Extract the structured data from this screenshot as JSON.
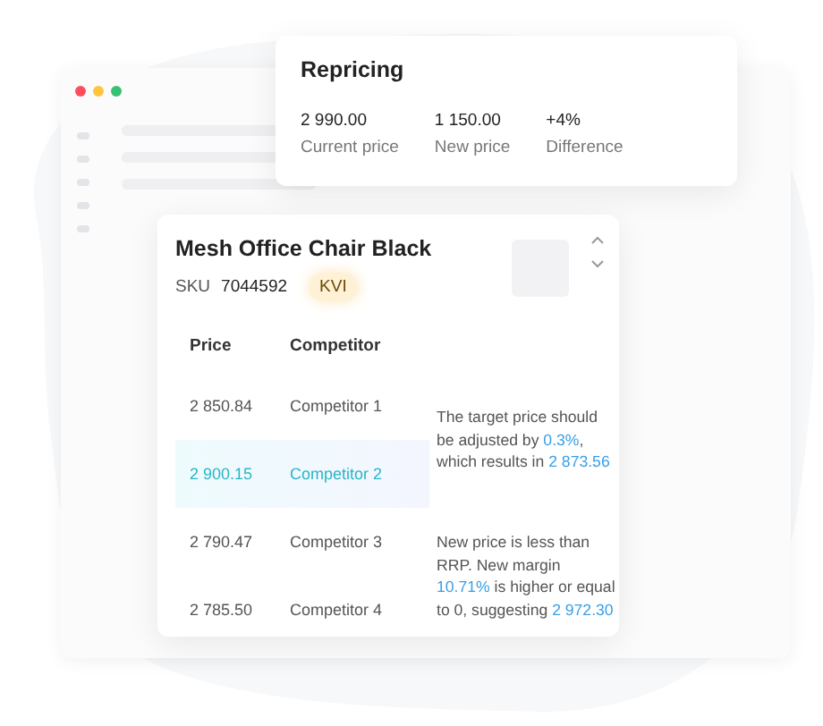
{
  "repricing": {
    "title": "Repricing",
    "metrics": [
      {
        "value": "2 990.00",
        "label": "Current price"
      },
      {
        "value": "1 150.00",
        "label": "New price"
      },
      {
        "value": "+4%",
        "label": "Difference"
      }
    ]
  },
  "product": {
    "title": "Mesh Office Chair Black",
    "sku_label": "SKU",
    "sku": "7044592",
    "badge": "KVI",
    "columns": [
      "Price",
      "Competitor"
    ],
    "rows": [
      {
        "price": "2 850.84",
        "competitor": "Competitor 1",
        "selected": false
      },
      {
        "price": "2 900.15",
        "competitor": "Competitor 2",
        "selected": true
      },
      {
        "price": "2 790.47",
        "competitor": "Competitor 3",
        "selected": false
      },
      {
        "price": "2 785.50",
        "competitor": "Competitor 4",
        "selected": false
      }
    ],
    "notes": [
      [
        {
          "text": "The target price should be adjusted by ",
          "highlight": false
        },
        {
          "text": "0.3%",
          "highlight": true
        },
        {
          "text": ", which results in ",
          "highlight": false
        },
        {
          "text": "2 873.56",
          "highlight": true
        }
      ],
      [
        {
          "text": "New price is less than RRP. New margin ",
          "highlight": false
        },
        {
          "text": "10.71%",
          "highlight": true
        },
        {
          "text": " is higher or equal to 0, suggesting ",
          "highlight": false
        },
        {
          "text": "2 972.30",
          "highlight": true
        }
      ]
    ]
  }
}
